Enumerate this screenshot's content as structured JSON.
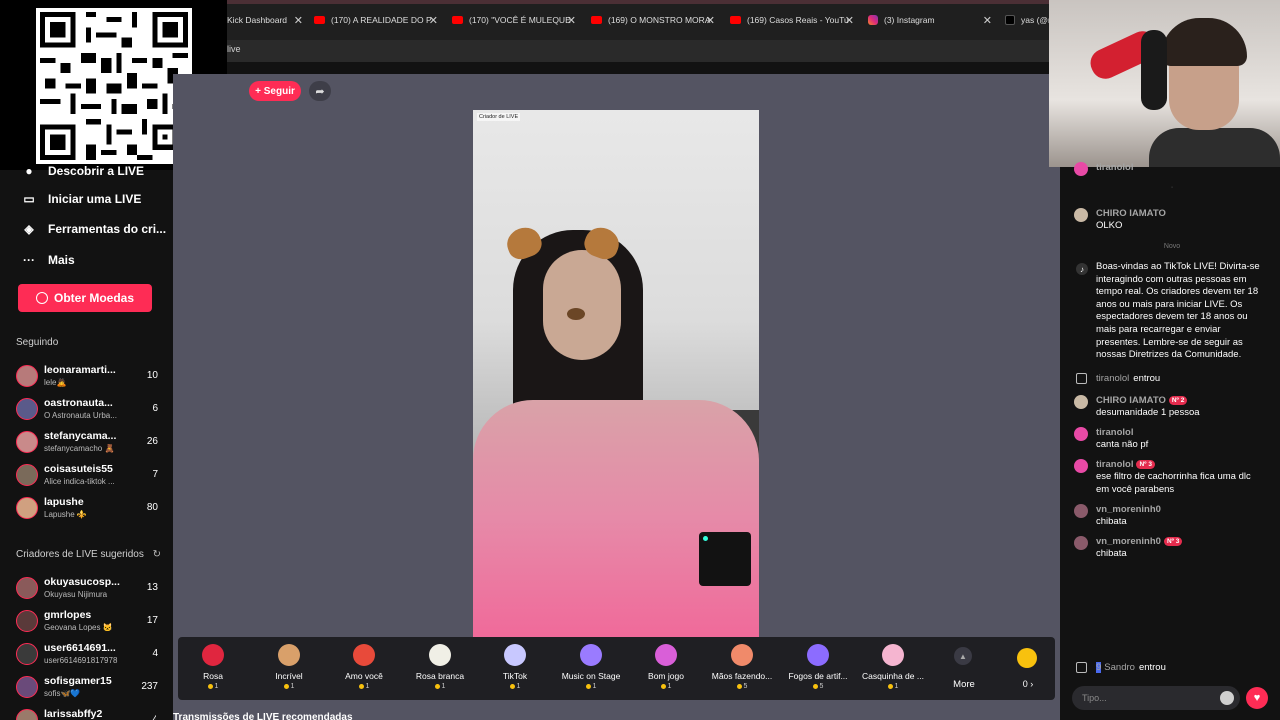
{
  "browser": {
    "tabs": [
      {
        "title": "Kick Dashboard",
        "icon": "kick-icon"
      },
      {
        "title": "(170) A REALIDADE DO P",
        "icon": "youtube-icon"
      },
      {
        "title": "(170) \"VOCÊ É MULEQUE",
        "icon": "youtube-icon"
      },
      {
        "title": "(169) O MONSTRO MORA",
        "icon": "youtube-icon"
      },
      {
        "title": "(169) Casos Reais - YouTu",
        "icon": "youtube-icon"
      },
      {
        "title": "(3) Instagram",
        "icon": "instagram-icon"
      },
      {
        "title": "yas (@n",
        "icon": "tiktok-icon"
      }
    ],
    "address_fragment": "live"
  },
  "sidebar": {
    "nav": [
      {
        "label": "Descobrir a LIVE",
        "icon": "discover-icon"
      },
      {
        "label": "Iniciar uma LIVE",
        "icon": "camera-icon"
      },
      {
        "label": "Ferramentas do cri...",
        "icon": "tools-icon"
      },
      {
        "label": "Mais",
        "icon": "more-dots-icon"
      }
    ],
    "coins_button": "Obter Moedas",
    "following_title": "Seguindo",
    "following": [
      {
        "name": "leonaramarti...",
        "sub": "lele🙇",
        "count": "10"
      },
      {
        "name": "oastronauta...",
        "sub": "O Astronauta Urba...",
        "count": "6"
      },
      {
        "name": "stefanycama...",
        "sub": "stefanycamacho 🧸",
        "count": "26"
      },
      {
        "name": "coisasuteis55",
        "sub": "Alice indica-tiktok ...",
        "count": "7"
      },
      {
        "name": "lapushe",
        "sub": "Lapushe ⚜️",
        "count": "80"
      }
    ],
    "suggested_title": "Criadores de LIVE sugeridos",
    "suggested": [
      {
        "name": "okuyasucosp...",
        "sub": "Okuyasu Nijimura",
        "count": "13"
      },
      {
        "name": "gmrlopes",
        "sub": "Geovana Lopes 🐱",
        "count": "17"
      },
      {
        "name": "user6614691...",
        "sub": "user6614691817978",
        "count": "4"
      },
      {
        "name": "sofisgamer15",
        "sub": "sofis🦋💙",
        "count": "237"
      },
      {
        "name": "larissabffy2",
        "sub": "",
        "count": "4"
      }
    ]
  },
  "live": {
    "follow_button": "+ Seguir",
    "creator_label": "Criador de LIVE",
    "bottom_note": "Transmissões de LIVE recomendadas"
  },
  "gifts": [
    {
      "name": "Rosa",
      "price": "1",
      "color": "#e0263f"
    },
    {
      "name": "Incrível",
      "price": "1",
      "color": "#d9a06a"
    },
    {
      "name": "Amo você",
      "price": "1",
      "color": "#e84a3a"
    },
    {
      "name": "Rosa branca",
      "price": "1",
      "color": "#f0efe6"
    },
    {
      "name": "TikTok",
      "price": "1",
      "color": "#c8c8ff"
    },
    {
      "name": "Music on Stage",
      "price": "1",
      "color": "#9a7bff"
    },
    {
      "name": "Bom jogo",
      "price": "1",
      "color": "#d95fd8"
    },
    {
      "name": "Mãos fazendo...",
      "price": "5",
      "color": "#f08a6a"
    },
    {
      "name": "Fogos de artif...",
      "price": "5",
      "color": "#8c6cff"
    },
    {
      "name": "Casquinha de ...",
      "price": "1",
      "color": "#f5b5d0"
    }
  ],
  "gifts_more": "More",
  "coins_count": "0 ›",
  "chat": {
    "top_user": "tiranolol",
    "messages": [
      {
        "user": "CHIRO IAMATO",
        "text": "OLKO",
        "badge": "",
        "avatar": "#c9b9a5"
      }
    ],
    "divider": "Novo",
    "welcome": "Boas-vindas ao TikTok LIVE! Divirta-se interagindo com outras pessoas em tempo real. Os criadores devem ter 18 anos ou mais para iniciar LIVE. Os espectadores devem ter 18 anos ou mais para recarregar e enviar presentes. Lembre-se de seguir as nossas Diretrizes da Comunidade.",
    "join1_user": "tiranolol",
    "join1_text": "entrou",
    "messages2": [
      {
        "user": "CHIRO IAMATO",
        "badge": "Nº 2",
        "text": "desumanidade 1 pessoa",
        "avatar": "#c9b9a5"
      },
      {
        "user": "tiranolol",
        "badge": "",
        "text": "canta não pf",
        "avatar": "#e84aa6"
      },
      {
        "user": "tiranolol",
        "badge": "Nº 3",
        "text": "ese filtro de cachorrinha fica uma dlc em você parabens",
        "avatar": "#e84aa6"
      },
      {
        "user": "vn_moreninh0",
        "badge": "",
        "text": "chibata",
        "avatar": "#8a5a6a"
      },
      {
        "user": "vn_moreninh0",
        "badge": "Nº 3",
        "text": "chibata",
        "avatar": "#8a5a6a"
      }
    ],
    "join2_level": "9",
    "join2_user": "Sandro",
    "join2_text": "entrou",
    "input_placeholder": "Tipo..."
  }
}
